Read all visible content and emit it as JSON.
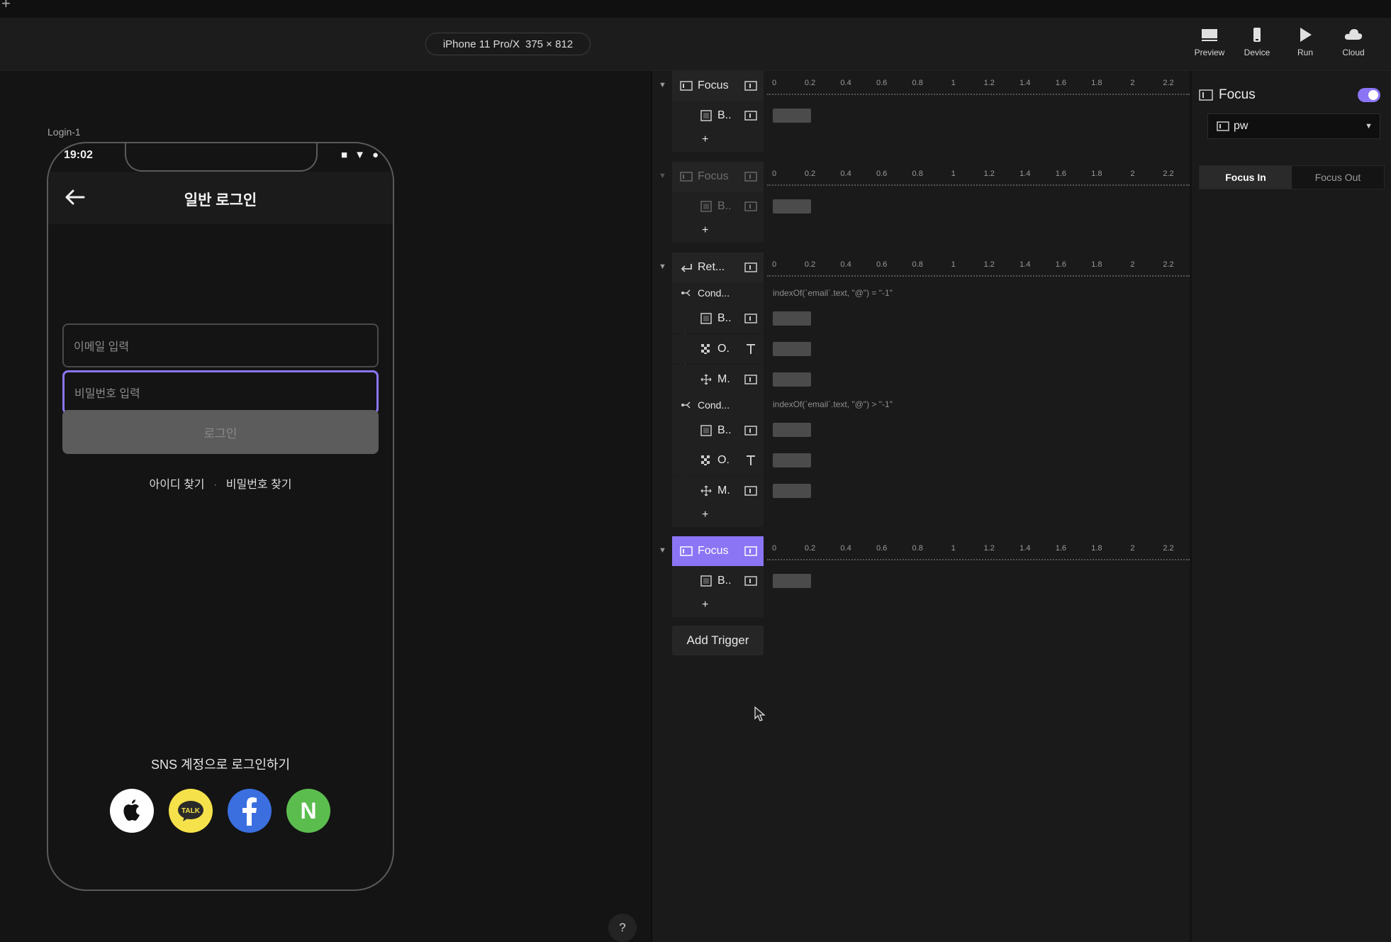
{
  "toolbar": {
    "device_name": "iPhone 11 Pro/X",
    "device_size": "375 × 812",
    "buttons": [
      {
        "label": "Preview",
        "icon": "preview-icon"
      },
      {
        "label": "Device",
        "icon": "device-icon"
      },
      {
        "label": "Run",
        "icon": "play-icon"
      },
      {
        "label": "Cloud",
        "icon": "cloud-icon"
      }
    ]
  },
  "canvas": {
    "frame_label": "Login-1",
    "phone": {
      "status_time": "19:02",
      "title": "일반 로그인",
      "email_placeholder": "이메일 입력",
      "password_placeholder": "비밀번호 입력",
      "login_label": "로그인",
      "find_id": "아이디 찾기",
      "separator": "·",
      "find_password": "비밀번호 찾기",
      "sns_title": "SNS 계정으로 로그인하기",
      "sns": [
        "apple",
        "kakao",
        "facebook",
        "naver"
      ],
      "kakao_text": "TALK",
      "naver_text": "N"
    },
    "help_label": "?"
  },
  "timeline": {
    "ticks": [
      "0",
      "0.2",
      "0.4",
      "0.6",
      "0.8",
      "1",
      "1.2",
      "1.4",
      "1.6",
      "1.8",
      "2",
      "2.2"
    ],
    "triggers": [
      {
        "label": "Focus",
        "children": [
          "B.."
        ]
      },
      {
        "label": "Focus",
        "children": [
          "B.."
        ]
      },
      {
        "label": "Ret...",
        "conditions": [
          {
            "label": "Cond...",
            "expr": "indexOf(`email`.text, \"@\") = \"-1\"",
            "children": [
              "B..",
              "O.",
              "M."
            ]
          },
          {
            "label": "Cond...",
            "expr": "indexOf(`email`.text, \"@\") > \"-1\"",
            "children": [
              "B..",
              "O.",
              "M."
            ]
          }
        ]
      },
      {
        "label": "Focus",
        "children": [
          "B.."
        ]
      }
    ],
    "add_label": "+",
    "add_trigger": "Add Trigger"
  },
  "properties": {
    "title": "Focus",
    "enabled": true,
    "target": "pw",
    "segments": [
      "Focus In",
      "Focus Out"
    ],
    "active_segment": "Focus In"
  },
  "colors": {
    "accent": "#8b75f5",
    "background": "#141414",
    "panel": "#1a1a1a",
    "kakao": "#f5e14a",
    "facebook": "#3b6fe0",
    "naver": "#5cbd4f"
  }
}
